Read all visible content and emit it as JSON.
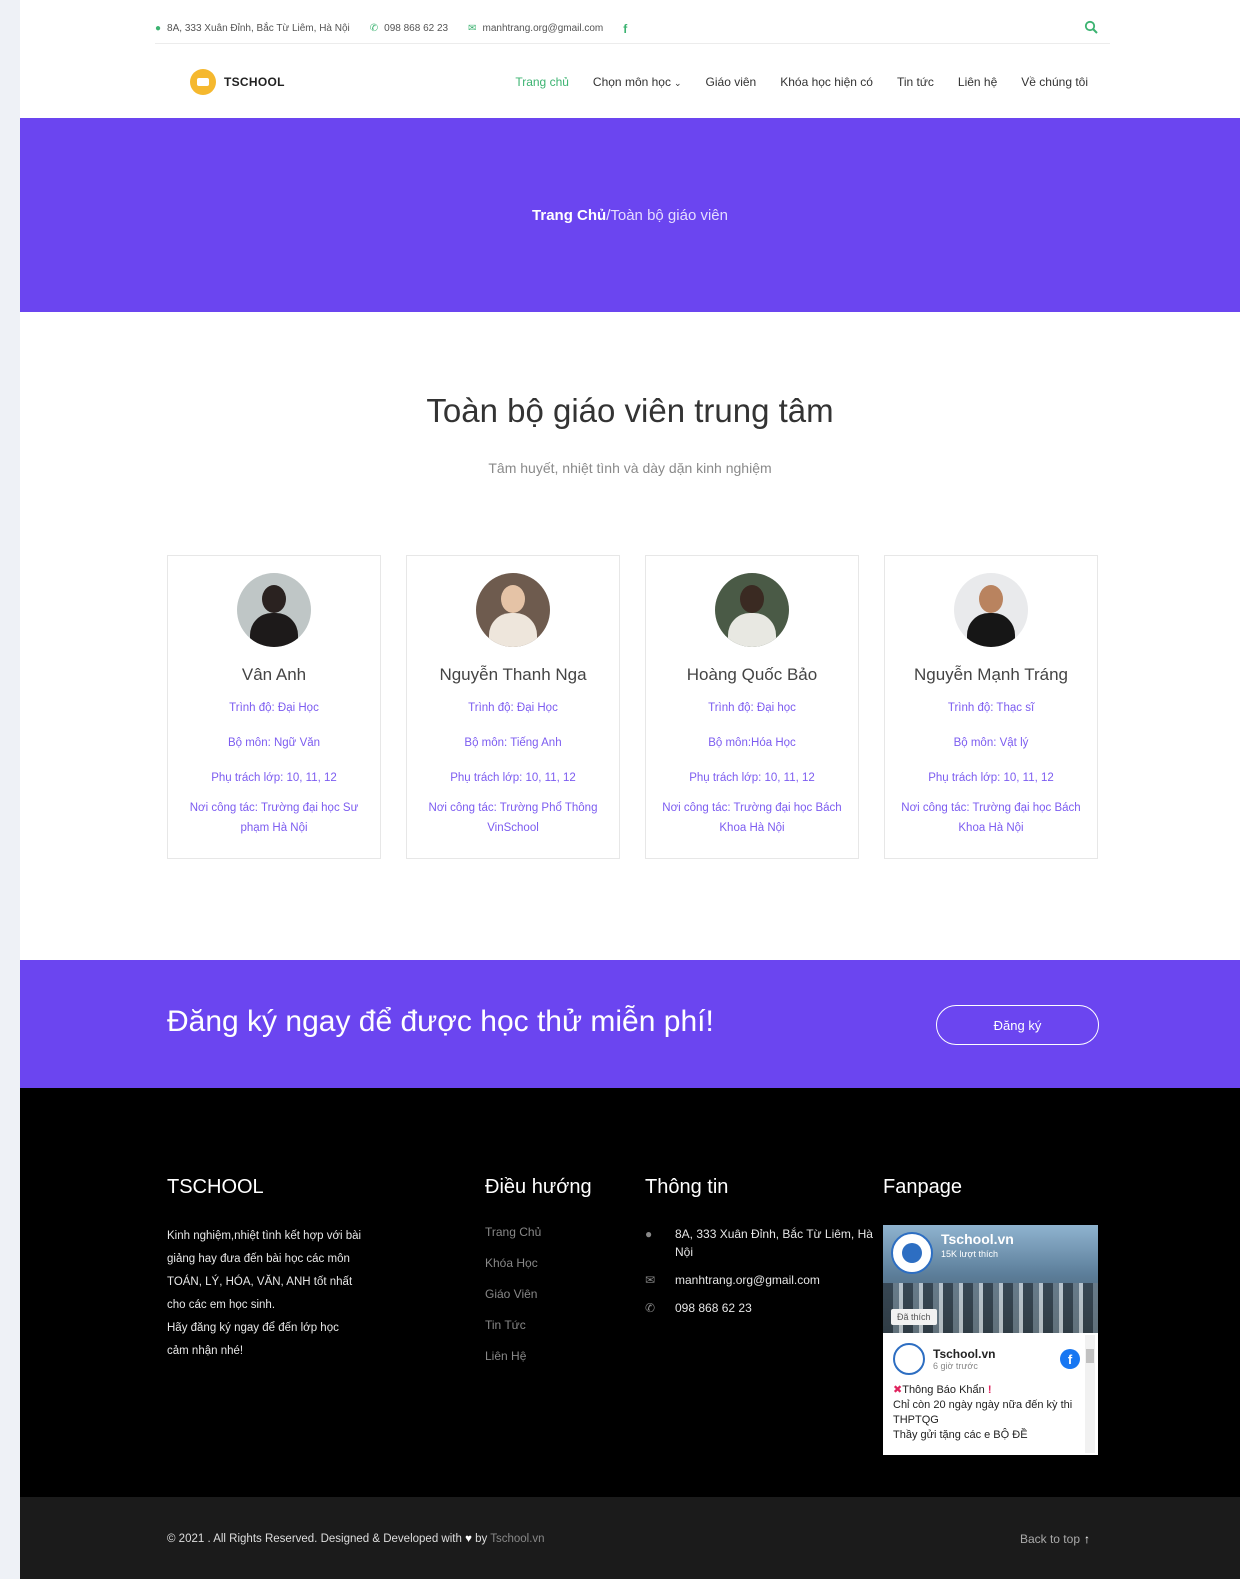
{
  "topbar": {
    "address": "8A, 333 Xuân Đỉnh, Bắc Từ Liêm, Hà Nội",
    "phone": "098 868 62 23",
    "email": "manhtrang.org@gmail.com",
    "facebook_glyph": "f",
    "search_glyph": "⚲"
  },
  "nav": {
    "logo_text": "TSCHOOL",
    "items": [
      {
        "label": "Trang chủ"
      },
      {
        "label": "Chọn môn học"
      },
      {
        "label": "Giáo viên"
      },
      {
        "label": "Khóa học hiện có"
      },
      {
        "label": "Tin tức"
      },
      {
        "label": "Liên hệ"
      },
      {
        "label": "Về chúng tôi"
      }
    ]
  },
  "hero": {
    "breadcrumb_home": "Trang Chủ",
    "breadcrumb_sep": "/",
    "breadcrumb_current": "Toàn bộ giáo viên"
  },
  "section": {
    "title": "Toàn bộ giáo viên trung tâm",
    "subtitle": "Tâm huyết, nhiệt tình và dày dặn kinh nghiệm"
  },
  "teachers": [
    {
      "name": "Vân Anh",
      "level": "Trình độ: Đại Học",
      "subject": "Bộ môn: Ngữ Văn",
      "grades": "Phụ trách lớp: 10, 11, 12",
      "workplace": "Nơi công tác: Trường đại học Sư phạm Hà Nội"
    },
    {
      "name": "Nguyễn Thanh Nga",
      "level": "Trình độ: Đại Học",
      "subject": "Bộ môn: Tiếng Anh",
      "grades": "Phụ trách lớp: 10, 11, 12",
      "workplace": "Nơi công tác: Trường Phổ Thông VinSchool"
    },
    {
      "name": "Hoàng Quốc Bảo",
      "level": "Trình độ: Đại học",
      "subject": "Bộ môn:Hóa Học",
      "grades": "Phụ trách lớp: 10, 11, 12",
      "workplace": "Nơi công tác: Trường đại học Bách Khoa Hà Nội"
    },
    {
      "name": "Nguyễn Mạnh Tráng",
      "level": "Trình độ: Thạc sĩ",
      "subject": "Bộ môn: Vật lý",
      "grades": "Phụ trách lớp: 10, 11, 12",
      "workplace": "Nơi công tác: Trường đại học Bách Khoa Hà Nội"
    }
  ],
  "cta": {
    "text": "Đăng ký ngay để được học thử miễn phí!",
    "button": "Đăng ký"
  },
  "footer": {
    "about_title": "TSCHOOL",
    "about_lines": [
      "Kinh nghiệm,nhiệt tình kết hợp với bài",
      "giảng hay đưa đến bài học các môn",
      "TOÁN, LÝ, HÓA, VĂN, ANH tốt nhất",
      "cho các em học sinh.",
      "Hãy đăng ký ngay để đến lớp học",
      "cảm nhận nhé!"
    ],
    "nav_title": "Điều hướng",
    "nav_links": [
      "Trang Chủ",
      "Khóa Học",
      "Giáo Viên",
      "Tin Tức",
      "Liên Hệ"
    ],
    "info_title": "Thông tin",
    "info_address": "8A, 333 Xuân Đỉnh, Bắc Từ Liêm, Hà Nội",
    "info_email": "manhtrang.org@gmail.com",
    "info_phone": "098 868 62 23",
    "fanpage_title": "Fanpage",
    "fb": {
      "page_name": "Tschool.vn",
      "likes": "15K lượt thích",
      "liked_button": "Đã thích",
      "post_author": "Tschool.vn",
      "post_time": "6 giờ trước",
      "post_line1": "Thông Báo Khẩn",
      "post_line2": "Chỉ còn 20 ngày ngày nữa đến kỳ thi THPTQG",
      "post_line3": "Thầy gửi tặng các e BỘ ĐỀ"
    }
  },
  "bottom": {
    "copyright_prefix": "© 2021 . All Rights Reserved. Designed & Developed with",
    "heart_glyph": "♥",
    "by": "by",
    "brand": "Tschool.vn",
    "back_to_top": "Back to top",
    "arrow_glyph": "↑"
  },
  "colors": {
    "accent_purple": "#6b45f0",
    "accent_green": "#3cb371",
    "footer_bg": "#000000",
    "bottom_bg": "#1b1b1b"
  }
}
